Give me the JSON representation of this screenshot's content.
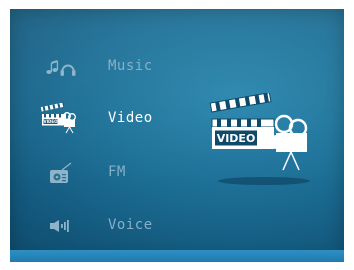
{
  "menu": {
    "items": [
      {
        "label": "Music",
        "icon": "music-notes-headphones-icon",
        "selected": false
      },
      {
        "label": "Video",
        "icon": "video-clapperboard-camera-icon",
        "selected": true
      },
      {
        "label": "FM",
        "icon": "radio-icon",
        "selected": false
      },
      {
        "label": "Voice",
        "icon": "speaker-volume-icon",
        "selected": false
      }
    ]
  },
  "preview": {
    "icon": "video-clapperboard-camera-icon",
    "badge_text": "VIDEO"
  },
  "colors": {
    "background": "#1d6f96",
    "bottom_bar": "#2a88bb",
    "label_inactive": "#86b0c6",
    "label_active": "#ffffff",
    "icon_inactive": "#7fa8bf"
  }
}
